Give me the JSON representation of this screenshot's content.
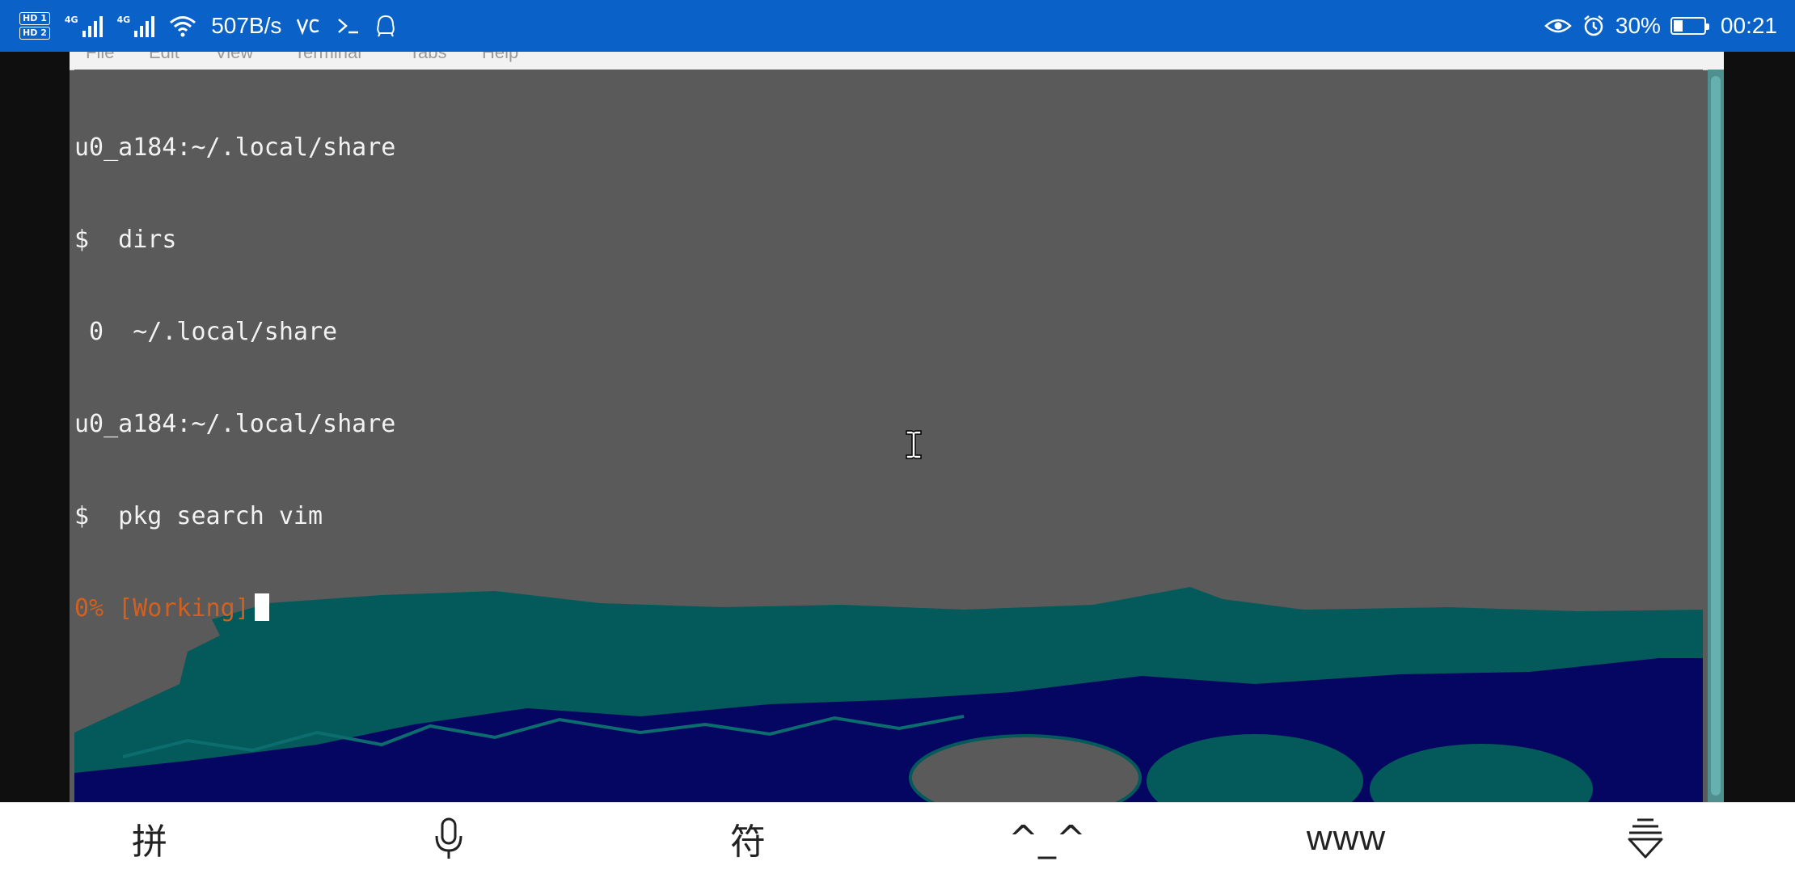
{
  "status_bar": {
    "sim1": "HD",
    "sim1_index": "1",
    "sim2": "HD",
    "sim2_index": "2",
    "network1": "4G",
    "network2": "4G",
    "speed": "507B/s",
    "battery_percent": "30%",
    "battery_level": 0.3,
    "time": "00:21",
    "icons": [
      "signal-icon",
      "signal-icon",
      "wifi-icon",
      "volte-icon",
      "terminal-icon",
      "qq-icon",
      "eye-comfort-icon",
      "alarm-icon",
      "battery-icon"
    ]
  },
  "terminal": {
    "menu": [
      "File",
      "Edit",
      "View",
      "Terminal",
      "Tabs",
      "Help"
    ],
    "lines": [
      "u0_a184:~/.local/share",
      "$  dirs",
      " 0  ~/.local/share",
      "u0_a184:~/.local/share",
      "$  pkg search vim"
    ],
    "progress_line": "0% [Working]",
    "colors": {
      "background": "#5a5a5a",
      "text": "#f2f2f2",
      "progress": "#d2601f",
      "teal": "#045a5a",
      "navy": "#050562"
    }
  },
  "keyboard_toolbar": {
    "pinyin": "拼",
    "symbols": "符",
    "emoticon": "^_^",
    "www": "www",
    "icons": [
      "microphone-icon",
      "collapse-keyboard-icon"
    ]
  }
}
